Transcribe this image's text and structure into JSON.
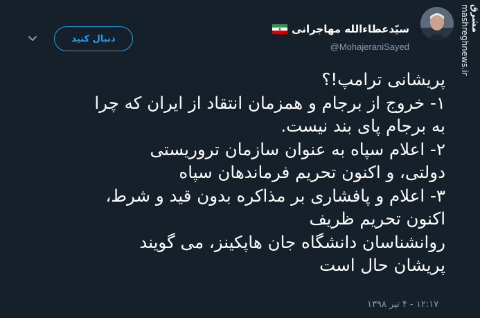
{
  "watermark": {
    "brand": "مشرق",
    "site": "mashreghnews.ir"
  },
  "author": {
    "display_name": "سیّدعطاءالله مهاجرانی",
    "handle": "@MohajeraniSayed",
    "flag_icon": "iran-flag-icon"
  },
  "follow_button": {
    "label": "دنبال کنید"
  },
  "tweet": {
    "lines": [
      "پریشانی ترامپ!؟",
      "۱- خروج از برجام و همزمان انتقاد از ایران که چرا",
      "به برجام پای بند نیست.",
      "۲- اعلام سپاه به عنوان سازمان تروریستی",
      "دولتی، و اکنون تحریم فرماندهان سپاه",
      "۳- اعلام و پافشاری بر مذاکره بدون قید و شرط،",
      "اکنون تحریم ظریف",
      "روانشناسان دانشگاه جان هاپکینز، می گویند",
      "پریشان حال است"
    ]
  },
  "timestamp": "۱۲:۱۷ - ۴ تیر ۱۳۹۸",
  "colors": {
    "background": "#15202b",
    "accent": "#1da1f2",
    "muted": "#8899a6",
    "text": "#ffffff"
  }
}
